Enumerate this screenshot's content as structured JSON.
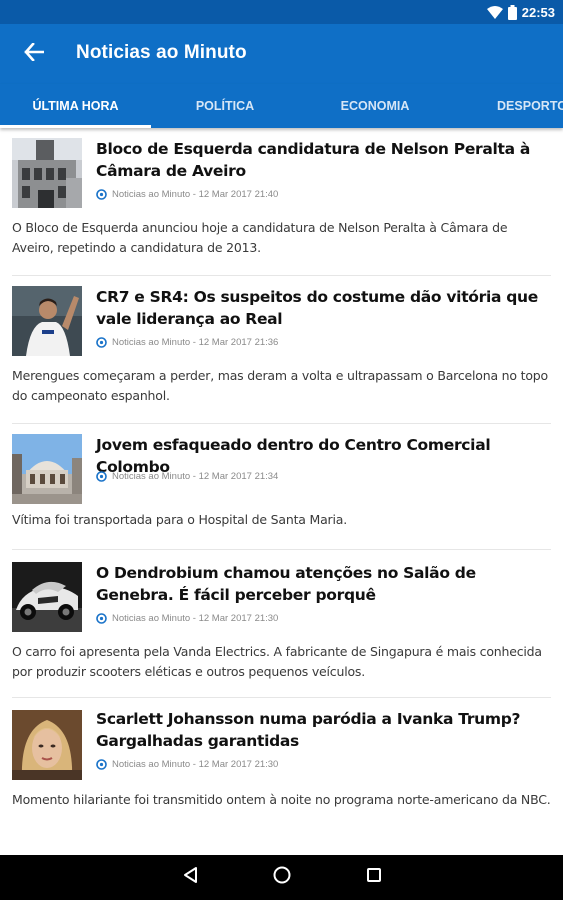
{
  "status_bar": {
    "time": "22:53",
    "icons": [
      "wifi-icon",
      "battery-icon"
    ]
  },
  "app_bar": {
    "title": "Noticias ao Minuto",
    "back_icon": "arrow-left-icon"
  },
  "tabs": [
    {
      "label": "Última hora",
      "active": true
    },
    {
      "label": "Política",
      "active": false
    },
    {
      "label": "Economia",
      "active": false
    },
    {
      "label": "Desporto",
      "active": false
    }
  ],
  "articles": [
    {
      "title": "Bloco de Esquerda candidatura de Nelson Peralta à Câmara de Aveiro",
      "source": "Noticias ao Minuto - 12 Mar 2017 21:40",
      "summary": "O Bloco de Esquerda anunciou hoje a candidatura de Nelson Peralta à Câmara de Aveiro, repetindo a candidatura de 2013.",
      "thumbnail": "building-photo"
    },
    {
      "title": "CR7 e SR4: Os suspeitos do costume dão vitória que vale liderança ao Real",
      "source": "Noticias ao Minuto - 12 Mar 2017 21:36",
      "summary": "Merengues começaram a perder, mas deram a volta e ultrapassam o Barcelona no topo do campeonato espanhol.",
      "thumbnail": "football-player-photo"
    },
    {
      "title": "Jovem esfaqueado dentro do Centro Comercial Colombo",
      "source": "Noticias ao Minuto - 12 Mar 2017 21:34",
      "summary": "Vítima foi transportada para o Hospital de Santa Maria.",
      "thumbnail": "shopping-center-photo"
    },
    {
      "title": "O Dendrobium chamou atenções no Salão de Genebra. É fácil perceber porquê",
      "source": "Noticias ao Minuto - 12 Mar 2017 21:30",
      "summary": "O carro foi apresenta pela Vanda Electrics. A fabricante de Singapura é mais conhecida por produzir scooters eléticas e outros pequenos veículos.",
      "thumbnail": "car-photo"
    },
    {
      "title": "Scarlett Johansson numa paródia a Ivanka Trump? Gargalhadas garantidas",
      "source": "Noticias ao Minuto - 12 Mar 2017 21:30",
      "summary": "Momento hilariante foi transmitido ontem à noite no programa norte-americano da NBC.",
      "thumbnail": "woman-portrait-photo"
    }
  ],
  "nav_bar": {
    "buttons": [
      "back-triangle-icon",
      "home-circle-icon",
      "recents-square-icon"
    ]
  },
  "colors": {
    "status_bar": "#0a5aa8",
    "app_bar": "#0f6fc6",
    "nav_bar": "#000000",
    "meta_text": "#8a8a8a"
  }
}
